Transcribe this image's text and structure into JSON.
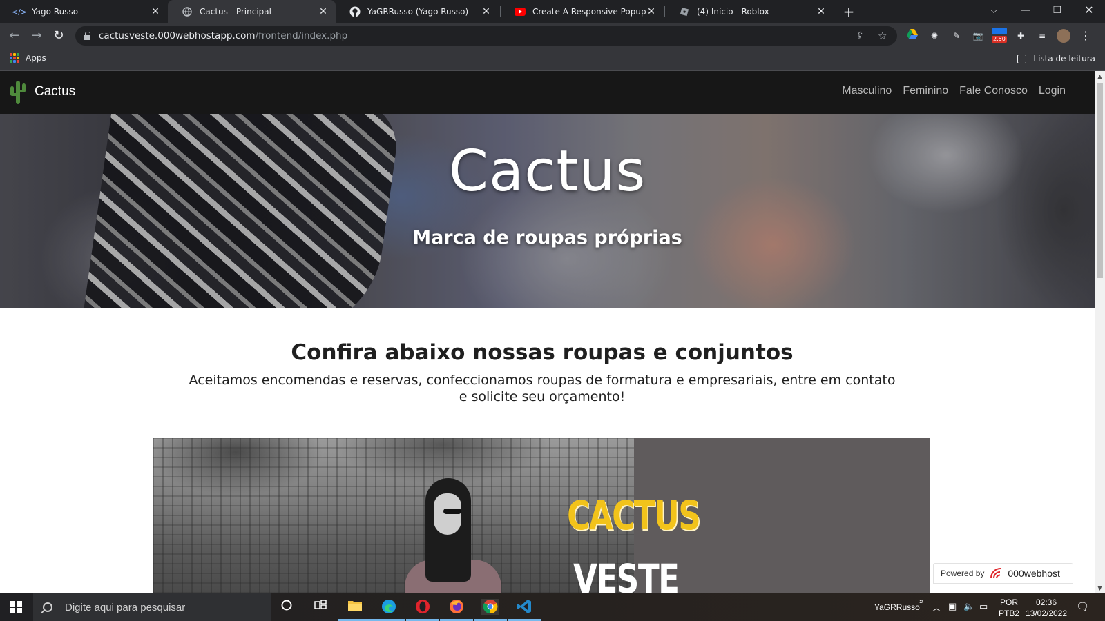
{
  "browser": {
    "tabs": [
      {
        "title": "Yago Russo",
        "icon": "code-icon",
        "active": false
      },
      {
        "title": "Cactus - Principal",
        "icon": "globe-icon",
        "active": true
      },
      {
        "title": "YaGRRusso (Yago Russo)",
        "icon": "github-icon",
        "active": false
      },
      {
        "title": "Create A Responsive Popup Imag",
        "icon": "youtube-icon",
        "active": false
      },
      {
        "title": "(4) Início - Roblox",
        "icon": "roblox-icon",
        "active": false
      }
    ],
    "url_host": "cactusveste.000webhostapp.com",
    "url_path": "/frontend/index.php",
    "ext_badge": "2.50",
    "bookmarks": {
      "apps_label": "Apps",
      "reading_list_label": "Lista de leitura"
    }
  },
  "site": {
    "brand": "Cactus",
    "nav": [
      "Masculino",
      "Feminino",
      "Fale Conosco",
      "Login"
    ],
    "hero": {
      "title": "Cactus",
      "subtitle": "Marca de roupas próprias"
    },
    "section": {
      "title": "Confira abaixo nossas roupas e conjuntos",
      "text": "Aceitamos encomendas e reservas, confeccionamos roupas de formatura e empresariais, entre em contato e solicite seu orçamento!"
    },
    "banner": {
      "line1": "CACTUS",
      "line2": "VESTE"
    },
    "powered": {
      "label": "Powered by",
      "host": "000webhost"
    }
  },
  "taskbar": {
    "search_placeholder": "Digite aqui para pesquisar",
    "user": "YaGRRusso",
    "overflow": "»",
    "lang_top": "POR",
    "lang_bottom": "PTB2",
    "time": "02:36",
    "date": "13/02/2022"
  },
  "colors": {
    "accent": "#4f8a3c",
    "nav_bg": "#171717",
    "banner_yellow": "#f2c31b"
  }
}
